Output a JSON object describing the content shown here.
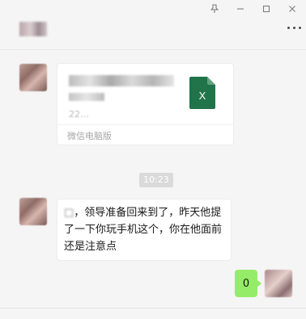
{
  "window": {
    "title": "",
    "pin_icon": "pin-icon",
    "minimize_icon": "minimize-icon",
    "maximize_icon": "maximize-icon",
    "close_icon": "close-icon",
    "more_icon": "more-dots-icon"
  },
  "messages": [
    {
      "type": "file",
      "sender": "other",
      "file_icon": "excel-file-icon",
      "file_size": "22…",
      "source": "微信电脑版"
    },
    {
      "type": "timestamp",
      "text": "10:23"
    },
    {
      "type": "text",
      "sender": "other",
      "text": "，领导准备回来到了，昨天他提了一下你玩手机这个，你在他面前还是注意点"
    },
    {
      "type": "text",
      "sender": "self",
      "text": "0"
    }
  ],
  "colors": {
    "self_bubble": "#95ec69",
    "excel_green": "#21744a",
    "background": "#f5f5f5"
  }
}
